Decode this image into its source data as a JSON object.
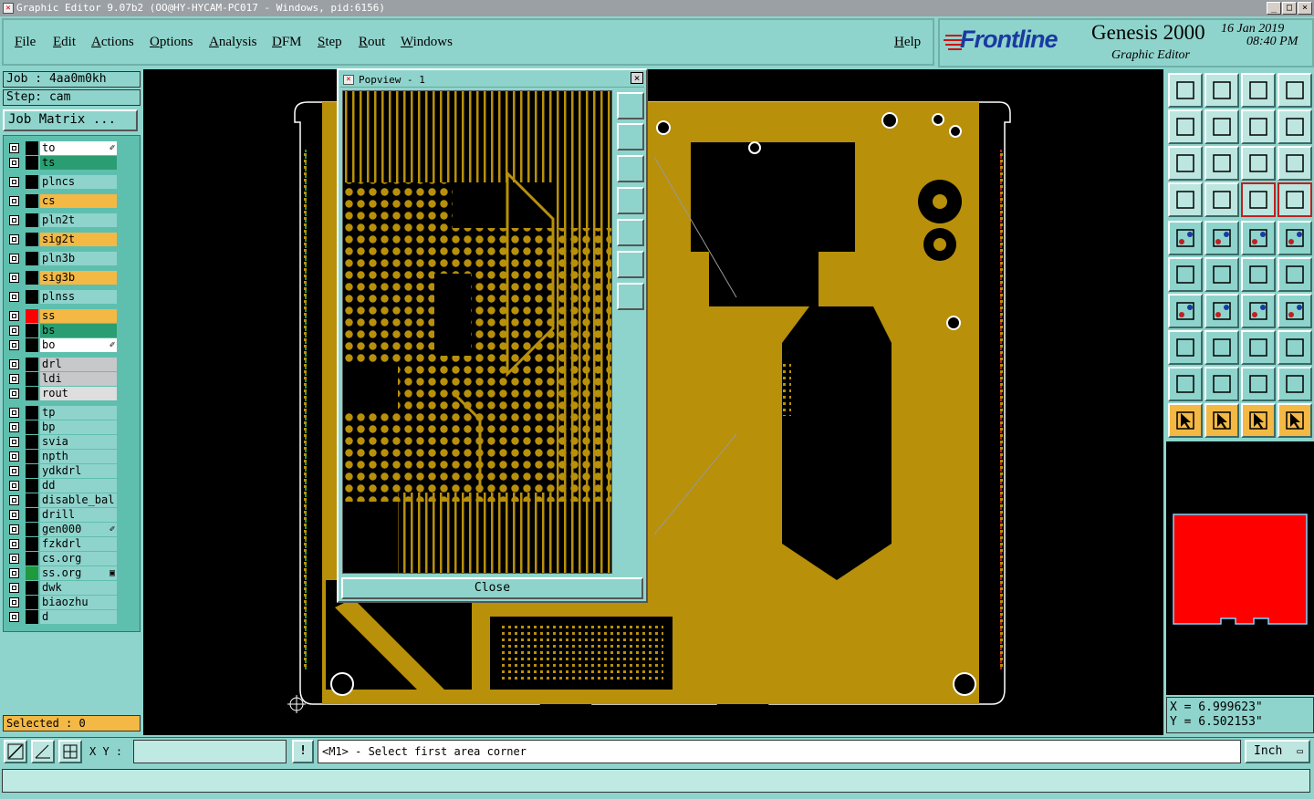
{
  "window": {
    "title": "Graphic Editor 9.07b2 (OO@HY-HYCAM-PC017 - Windows, pid:6156)",
    "controls": [
      "_",
      "□",
      "×"
    ]
  },
  "menu": {
    "items": [
      "File",
      "Edit",
      "Actions",
      "Options",
      "Analysis",
      "DFM",
      "Step",
      "Rout",
      "Windows"
    ],
    "help": "Help"
  },
  "brand": {
    "logo": "Frontline",
    "product": "Genesis 2000",
    "subtitle": "Graphic Editor",
    "date": "16 Jan 2019",
    "time": "08:40 PM"
  },
  "job": {
    "job_label": "Job : 4aa0m0kh",
    "step_label": "Step: cam",
    "matrix_button": "Job Matrix ..."
  },
  "layers": [
    {
      "name": "to",
      "style": "white",
      "swatch": "#000000",
      "mark": "✐"
    },
    {
      "name": "ts",
      "style": "green",
      "swatch": "#000000",
      "mark": ""
    },
    {
      "name": "plncs",
      "style": "teal",
      "swatch": "#000000",
      "mark": ""
    },
    {
      "name": "cs",
      "style": "orange",
      "swatch": "#000000",
      "mark": ""
    },
    {
      "name": "pln2t",
      "style": "teal",
      "swatch": "#000000",
      "mark": ""
    },
    {
      "name": "sig2t",
      "style": "orange",
      "swatch": "#000000",
      "mark": ""
    },
    {
      "name": "pln3b",
      "style": "teal",
      "swatch": "#000000",
      "mark": ""
    },
    {
      "name": "sig3b",
      "style": "orange",
      "swatch": "#000000",
      "mark": ""
    },
    {
      "name": "plnss",
      "style": "teal",
      "swatch": "#000000",
      "mark": ""
    },
    {
      "name": "ss",
      "style": "orange",
      "swatch": "#ff0000",
      "mark": ""
    },
    {
      "name": "bs",
      "style": "green",
      "swatch": "#000000",
      "mark": ""
    },
    {
      "name": "bo",
      "style": "white",
      "swatch": "#000000",
      "mark": "✐"
    },
    {
      "name": "drl",
      "style": "gray",
      "swatch": "#000000",
      "mark": ""
    },
    {
      "name": "ldi",
      "style": "gray",
      "swatch": "#000000",
      "mark": ""
    },
    {
      "name": "rout",
      "style": "lgray",
      "swatch": "#000000",
      "mark": ""
    },
    {
      "name": "tp",
      "style": "teal",
      "swatch": "#000000",
      "mark": ""
    },
    {
      "name": "bp",
      "style": "teal",
      "swatch": "#000000",
      "mark": ""
    },
    {
      "name": "svia",
      "style": "teal",
      "swatch": "#000000",
      "mark": ""
    },
    {
      "name": "npth",
      "style": "teal",
      "swatch": "#000000",
      "mark": ""
    },
    {
      "name": "ydkdrl",
      "style": "teal",
      "swatch": "#000000",
      "mark": ""
    },
    {
      "name": "dd",
      "style": "teal",
      "swatch": "#000000",
      "mark": ""
    },
    {
      "name": "disable_bal",
      "style": "teal",
      "swatch": "#000000",
      "mark": ""
    },
    {
      "name": "drill",
      "style": "teal",
      "swatch": "#000000",
      "mark": ""
    },
    {
      "name": "gen000",
      "style": "teal",
      "swatch": "#000000",
      "mark": "✐"
    },
    {
      "name": "fzkdrl",
      "style": "teal",
      "swatch": "#000000",
      "mark": ""
    },
    {
      "name": "cs.org",
      "style": "teal",
      "swatch": "#000000",
      "mark": ""
    },
    {
      "name": "ss.org",
      "style": "teal",
      "swatch": "#1e9a3c",
      "mark": "▣"
    },
    {
      "name": "dwk",
      "style": "teal",
      "swatch": "#000000",
      "mark": ""
    },
    {
      "name": "biaozhu",
      "style": "teal",
      "swatch": "#000000",
      "mark": ""
    },
    {
      "name": "d",
      "style": "teal",
      "swatch": "#000000",
      "mark": ""
    }
  ],
  "selected": "Selected : 0",
  "popview": {
    "title": "Popview - 1",
    "close_x": "×",
    "close_button": "Close"
  },
  "coords": {
    "x": "X = 6.999623\"",
    "y": "Y = 6.502153\""
  },
  "bottom": {
    "xy_label": "X Y :",
    "xy_value": "",
    "exclaim": "!",
    "prompt": "<M1> - Select first area corner",
    "units": "Inch"
  },
  "colors": {
    "copper": "#b8900a",
    "ui_teal": "#8fd4cc",
    "highlight_red": "#ff0000"
  }
}
